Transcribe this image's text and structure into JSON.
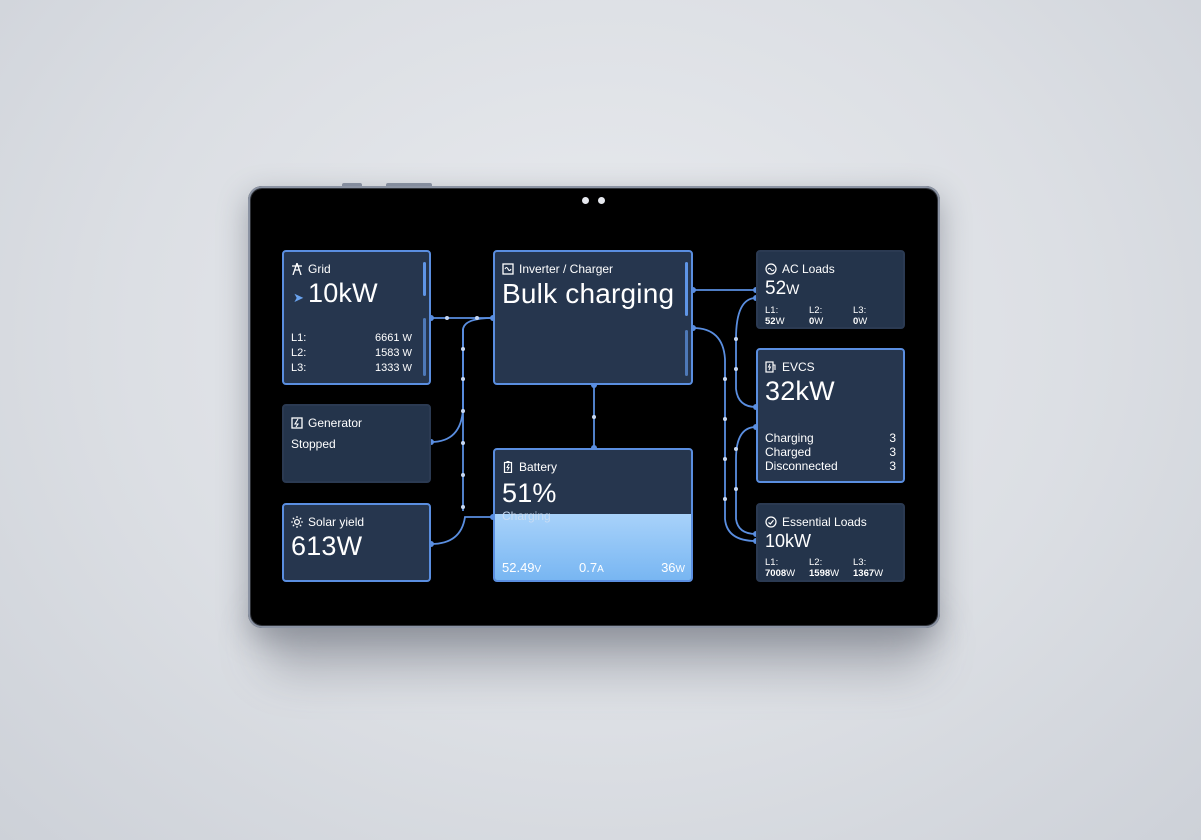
{
  "grid": {
    "title": "Grid",
    "value": "10kW",
    "rows": [
      {
        "label": "L1:",
        "value": "6661",
        "unit": "W"
      },
      {
        "label": "L2:",
        "value": "1583",
        "unit": "W"
      },
      {
        "label": "L3:",
        "value": "1333",
        "unit": "W"
      }
    ]
  },
  "generator": {
    "title": "Generator",
    "status": "Stopped"
  },
  "solar": {
    "title": "Solar yield",
    "value": "613W"
  },
  "inverter": {
    "title": "Inverter / Charger",
    "state": "Bulk charging"
  },
  "battery": {
    "title": "Battery",
    "soc": "51%",
    "soc_fraction": 0.51,
    "status": "Charging",
    "voltage": "52.49",
    "voltage_unit": "V",
    "current": "0.7",
    "current_unit": "A",
    "power": "36",
    "power_unit": "W"
  },
  "ac_loads": {
    "title": "AC Loads",
    "value": "52",
    "unit": "W",
    "phases": [
      {
        "label": "L1:",
        "value": "52",
        "unit": "W"
      },
      {
        "label": "L2:",
        "value": "0",
        "unit": "W"
      },
      {
        "label": "L3:",
        "value": "0",
        "unit": "W"
      }
    ]
  },
  "evcs": {
    "title": "EVCS",
    "value": "32kW",
    "rows": [
      {
        "label": "Charging",
        "value": "3"
      },
      {
        "label": "Charged",
        "value": "3"
      },
      {
        "label": "Disconnected",
        "value": "3"
      }
    ]
  },
  "essential": {
    "title": "Essential Loads",
    "value": "10kW",
    "phases": [
      {
        "label": "L1:",
        "value": "7008",
        "unit": "W"
      },
      {
        "label": "L2:",
        "value": "1598",
        "unit": "W"
      },
      {
        "label": "L3:",
        "value": "1367",
        "unit": "W"
      }
    ]
  },
  "colors": {
    "accent": "#5a8ee0",
    "panel": "#26364e",
    "battery_fill": "#8ec4f6"
  },
  "icons": {
    "grid": "power-tower-icon",
    "generator": "generator-icon",
    "solar": "sun-icon",
    "inverter": "inverter-icon",
    "battery": "battery-icon",
    "ac_loads": "ac-wave-icon",
    "evcs": "ev-charger-icon",
    "essential": "essential-loads-icon",
    "flow": "play-arrow-icon"
  }
}
